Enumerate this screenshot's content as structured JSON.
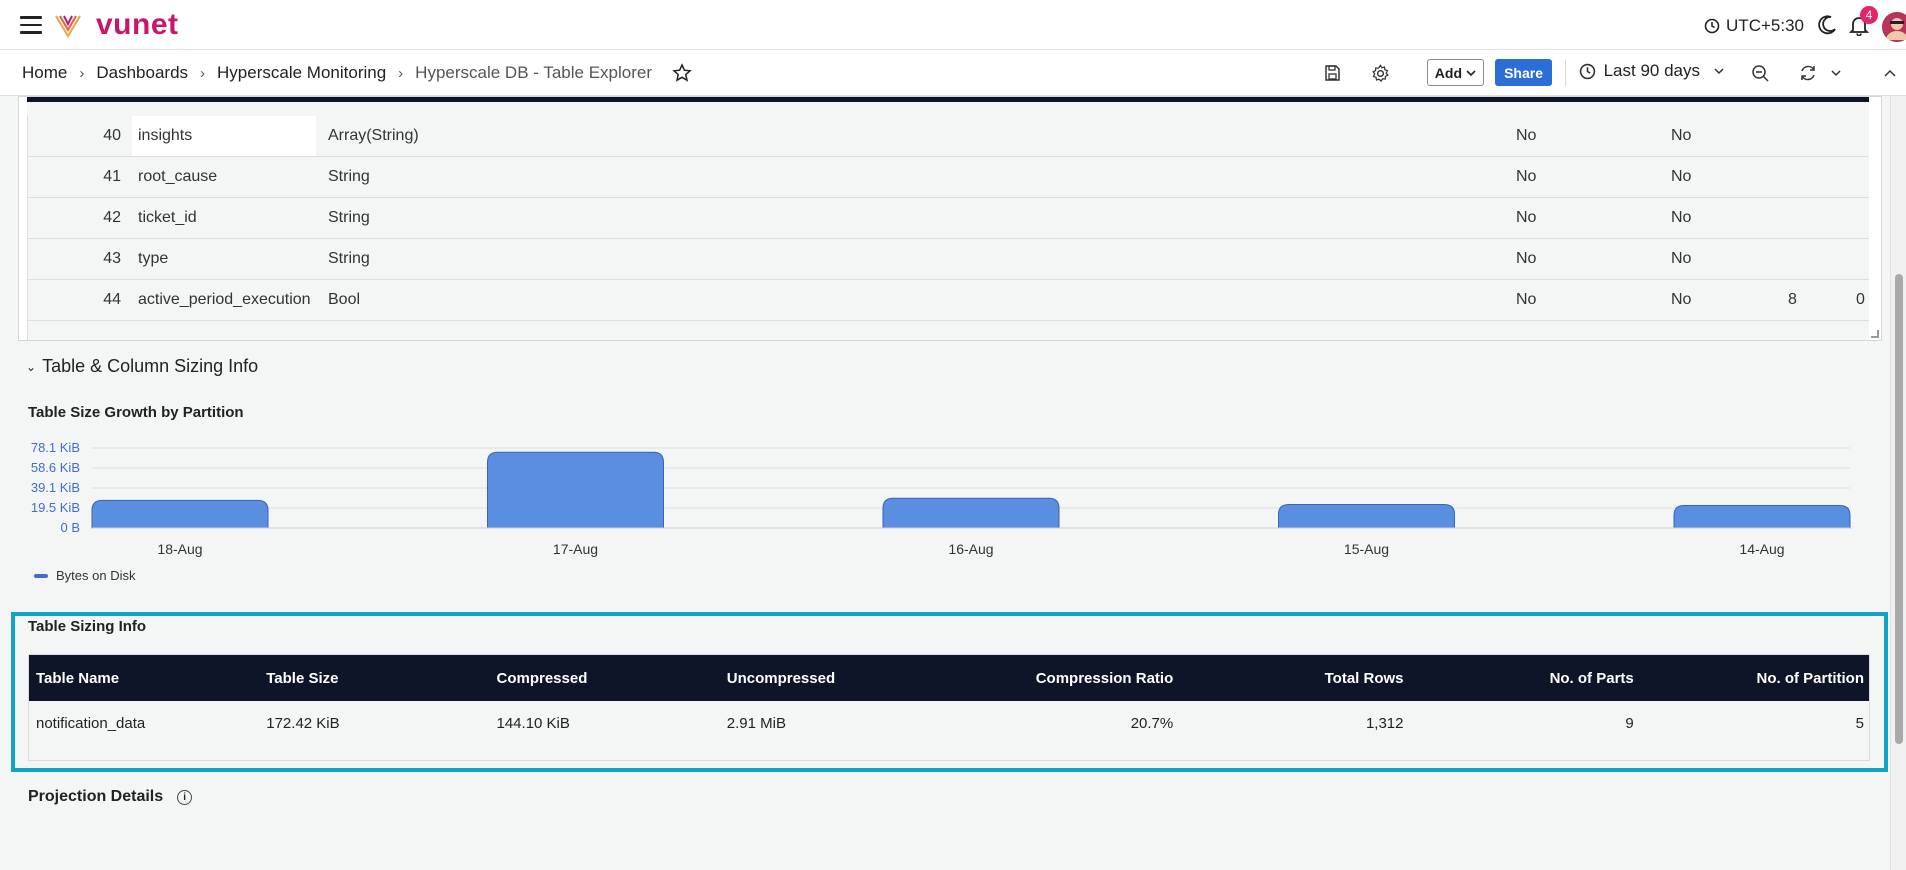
{
  "header": {
    "logo_text": "vunet",
    "timezone": "UTC+5:30",
    "notification_count": "4"
  },
  "breadcrumb": {
    "items": [
      "Home",
      "Dashboards",
      "Hyperscale Monitoring"
    ],
    "current": "Hyperscale DB - Table Explorer"
  },
  "toolbar": {
    "add_label": "Add",
    "share_label": "Share",
    "time_range": "Last 90 days"
  },
  "columns_table": {
    "rows": [
      {
        "idx": "40",
        "name": "insights",
        "type": "Array(String)",
        "a": "No",
        "b": "No",
        "c": "",
        "d": ""
      },
      {
        "idx": "41",
        "name": "root_cause",
        "type": "String",
        "a": "No",
        "b": "No",
        "c": "",
        "d": ""
      },
      {
        "idx": "42",
        "name": "ticket_id",
        "type": "String",
        "a": "No",
        "b": "No",
        "c": "",
        "d": ""
      },
      {
        "idx": "43",
        "name": "type",
        "type": "String",
        "a": "No",
        "b": "No",
        "c": "",
        "d": ""
      },
      {
        "idx": "44",
        "name": "active_period_execution",
        "type": "Bool",
        "a": "No",
        "b": "No",
        "c": "8",
        "d": "0"
      }
    ]
  },
  "section": {
    "title": "Table & Column Sizing Info"
  },
  "chart_data": {
    "type": "bar",
    "title": "Table Size Growth by Partition",
    "categories": [
      "18-Aug",
      "17-Aug",
      "16-Aug",
      "15-Aug",
      "14-Aug"
    ],
    "series": [
      {
        "name": "Bytes on Disk",
        "values": [
          27,
          74,
          29,
          23,
          22
        ]
      }
    ],
    "unit": "KiB",
    "yticks": [
      "0 B",
      "19.5 KiB",
      "39.1 KiB",
      "58.6 KiB",
      "78.1 KiB"
    ],
    "ytick_values": [
      0,
      19.5,
      39.1,
      58.6,
      78.1
    ],
    "ylim": [
      0,
      78.1
    ],
    "bar_color": "#5a8ee0",
    "grid": true,
    "legend_position": "bottom-left"
  },
  "sizing_info": {
    "title": "Table Sizing Info",
    "headers": [
      "Table Name",
      "Table Size",
      "Compressed",
      "Uncompressed",
      "Compression Ratio",
      "Total Rows",
      "No. of Parts",
      "No. of Partition"
    ],
    "row": [
      "notification_data",
      "172.42 KiB",
      "144.10 KiB",
      "2.91 MiB",
      "20.7%",
      "1,312",
      "9",
      "5"
    ]
  },
  "projection": {
    "title": "Projection Details"
  },
  "colors": {
    "brand": "#c4186c",
    "accent": "#2b6fd6",
    "table_header": "#0e1528",
    "highlight": "#12a4c6"
  }
}
